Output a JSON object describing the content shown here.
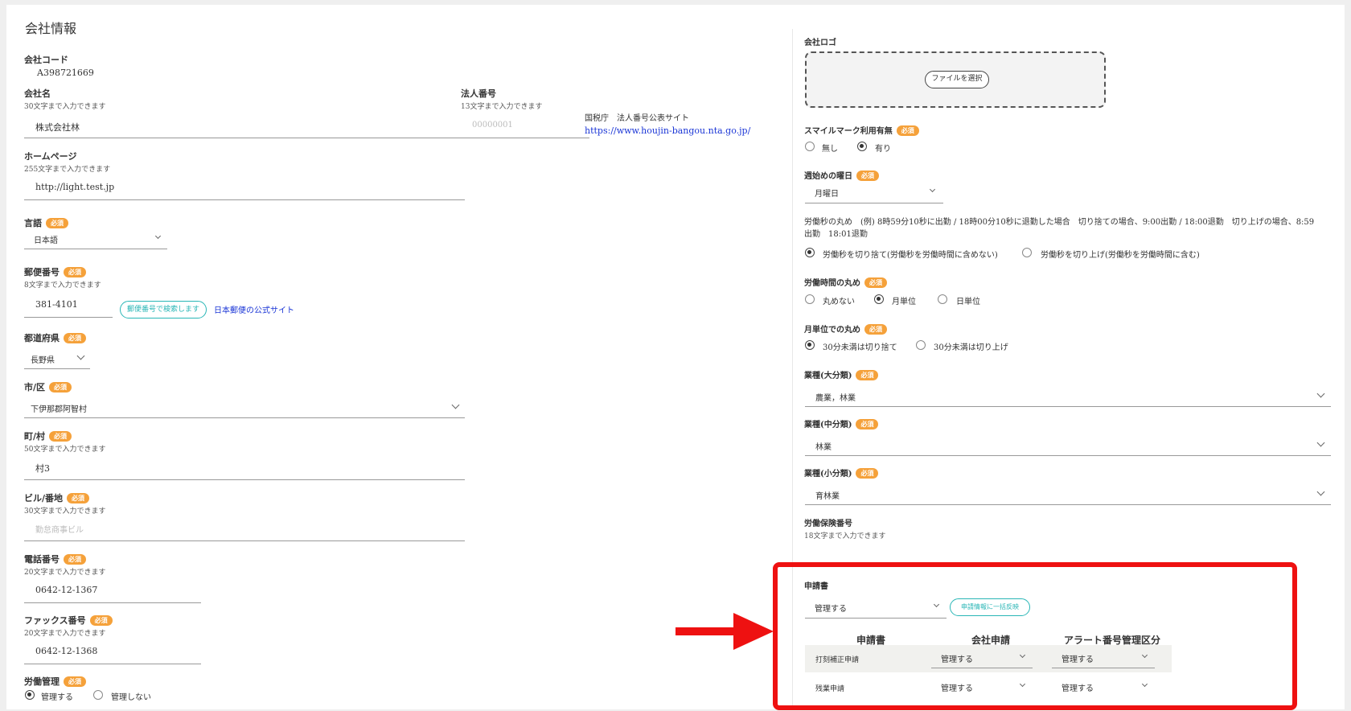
{
  "page_title": "会社情報",
  "left": {
    "company_code": {
      "label": "会社コード",
      "value": "A398721669"
    },
    "company_name": {
      "label": "会社名",
      "hint": "30文字まで入力できます",
      "value": "株式会社林"
    },
    "corporate_number": {
      "label": "法人番号",
      "hint": "13文字まで入力できます",
      "placeholder": "00000001",
      "site_label": "国税庁　法人番号公表サイト",
      "site_link": "https://www.houjin-bangou.nta.go.jp/"
    },
    "homepage": {
      "label": "ホームページ",
      "hint": "255文字まで入力できます",
      "value": "http://light.test.jp"
    },
    "language": {
      "label": "言語",
      "value": "日本語"
    },
    "postal_code": {
      "label": "郵便番号",
      "hint": "8文字まで入力できます",
      "value": "381-4101",
      "search_button": "郵便番号で検索します",
      "site_link": "日本郵便の公式サイト"
    },
    "prefecture": {
      "label": "都道府県",
      "value": "長野県"
    },
    "city": {
      "label": "市/区",
      "value": "下伊那郡阿智村"
    },
    "town": {
      "label": "町/村",
      "hint": "50文字まで入力できます",
      "value": "村3"
    },
    "building": {
      "label": "ビル/番地",
      "hint": "30文字まで入力できます",
      "placeholder": "勤怠商事ビル"
    },
    "phone": {
      "label": "電話番号",
      "hint": "20文字まで入力できます",
      "value": "0642-12-1367"
    },
    "fax": {
      "label": "ファックス番号",
      "hint": "20文字まで入力できます",
      "value": "0642-12-1368"
    },
    "labor_management": {
      "label": "労働管理",
      "options": [
        "管理する",
        "管理しない"
      ],
      "selected": 0
    }
  },
  "right": {
    "logo": {
      "label": "会社ロゴ",
      "button": "ファイルを選択"
    },
    "smile_mark": {
      "label": "スマイルマーク利用有無",
      "options": [
        "無し",
        "有り"
      ],
      "selected": 1
    },
    "week_start": {
      "label": "週始めの曜日",
      "value": "月曜日"
    },
    "seconds_rounding": {
      "label_line1": "労働秒の丸め　(例) 8時59分10秒に出勤 / 18時00分10秒に退勤した場合　切り捨ての場合、9:00出勤 / 18:00退勤　切り上げの場合、8:59",
      "label_line2": "出勤　18:01退勤",
      "options": [
        "労働秒を切り捨て(労働秒を労働時間に含めない)",
        "労働秒を切り上げ(労働秒を労働時間に含む)"
      ],
      "selected": 0
    },
    "time_rounding": {
      "label": "労働時間の丸め",
      "options": [
        "丸めない",
        "月単位",
        "日単位"
      ],
      "selected": 1
    },
    "monthly_rounding": {
      "label": "月単位での丸め",
      "options": [
        "30分未満は切り捨て",
        "30分未満は切り上げ"
      ],
      "selected": 0
    },
    "industry_major": {
      "label": "業種(大分類)",
      "value": "農業，林業"
    },
    "industry_middle": {
      "label": "業種(中分類)",
      "value": "林業"
    },
    "industry_minor": {
      "label": "業種(小分類)",
      "value": "育林業"
    },
    "labor_insurance": {
      "label": "労働保険番号",
      "hint": "18文字まで入力できます"
    },
    "application": {
      "label": "申請書",
      "value": "管理する",
      "bulk_button": "申請情報に一括反映",
      "headers": [
        "申請書",
        "会社申請",
        "アラート番号管理区分"
      ],
      "rows": [
        {
          "name": "打刻補正申請",
          "company": "管理する",
          "alert": "管理する"
        },
        {
          "name": "残業申請",
          "company": "管理する",
          "alert": "管理する"
        }
      ]
    }
  },
  "required_badge": "必須",
  "colors": {
    "required": "#f5a13a",
    "accent": "#29b6b6",
    "link": "#1a35d6",
    "highlight": "#ee1111",
    "row_shade": "#f1f1ee"
  }
}
